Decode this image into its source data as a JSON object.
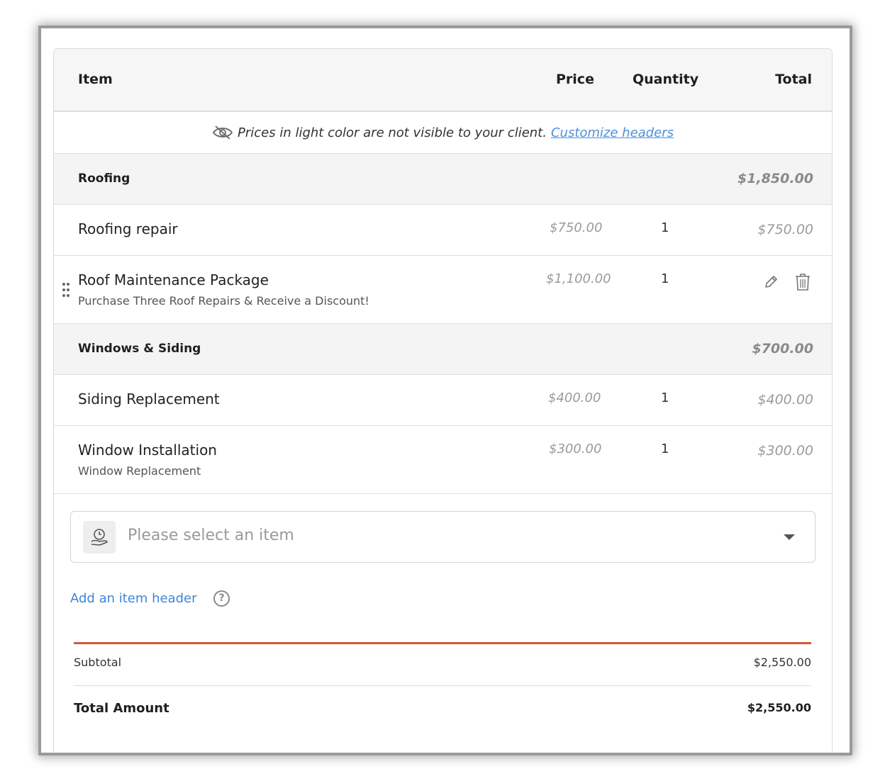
{
  "table": {
    "headers": {
      "item": "Item",
      "price": "Price",
      "quantity": "Quantity",
      "total": "Total"
    },
    "notice": {
      "text": "Prices in light color are not visible to your client.",
      "link": "Customize headers"
    },
    "groups": [
      {
        "name": "Roofing",
        "total": "$1,850.00",
        "items": [
          {
            "name": "Roofing repair",
            "description": "",
            "price": "$750.00",
            "quantity": "1",
            "total": "$750.00"
          },
          {
            "name": "Roof Maintenance Package",
            "description": "Purchase Three Roof Repairs & Receive a Discount!",
            "price": "$1,100.00",
            "quantity": "1",
            "total": ""
          }
        ]
      },
      {
        "name": "Windows & Siding",
        "total": "$700.00",
        "items": [
          {
            "name": "Siding Replacement",
            "description": "",
            "price": "$400.00",
            "quantity": "1",
            "total": "$400.00"
          },
          {
            "name": "Window Installation",
            "description": "Window Replacement",
            "price": "$300.00",
            "quantity": "1",
            "total": "$300.00"
          }
        ]
      }
    ]
  },
  "item_select": {
    "placeholder": "Please select an item"
  },
  "add_header": {
    "label": "Add an item header",
    "help": "?"
  },
  "summary": {
    "subtotal_label": "Subtotal",
    "subtotal_value": "$2,550.00",
    "total_label": "Total Amount",
    "total_value": "$2,550.00"
  },
  "colors": {
    "accent": "#d8553b",
    "link": "#3d86d6",
    "muted": "#9a9a9a"
  }
}
